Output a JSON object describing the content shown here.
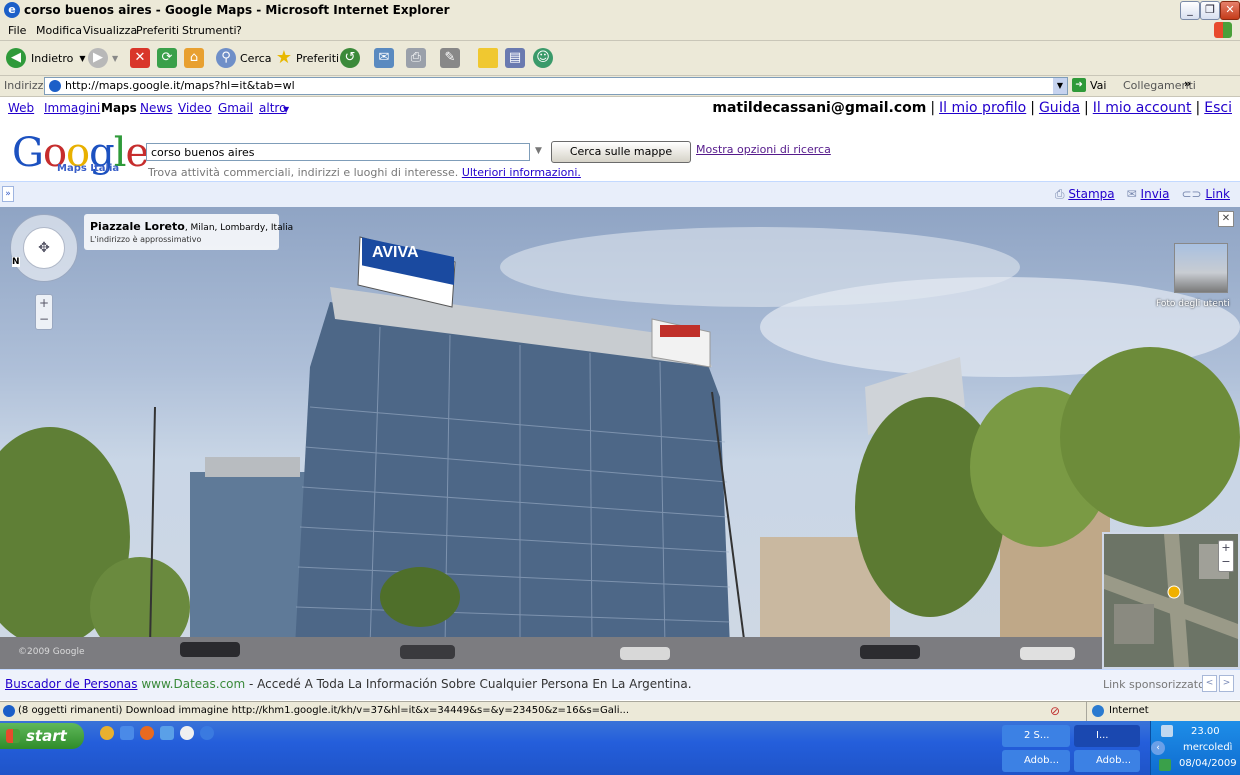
{
  "window": {
    "title": "corso buenos aires - Google Maps - Microsoft Internet Explorer"
  },
  "menu": [
    "File",
    "Modifica",
    "Visualizza",
    "Preferiti",
    "Strumenti",
    "?"
  ],
  "toolbar": {
    "back_label": "Indietro",
    "search_label": "Cerca",
    "favorites_label": "Preferiti"
  },
  "address": {
    "label": "Indirizzo",
    "url": "http://maps.google.it/maps?hl=it&tab=wl",
    "go_label": "Vai",
    "links_label": "Collegamenti"
  },
  "google_nav": {
    "links": [
      "Web",
      "Immagini",
      "Maps",
      "News",
      "Video",
      "Gmail",
      "altro"
    ],
    "active": "Maps",
    "user_email": "matildecassani@gmail.com",
    "account_links": [
      "Il mio profilo",
      "Guida",
      "Il mio account",
      "Esci"
    ]
  },
  "logo": {
    "text": "Google",
    "sub": "Maps Italia"
  },
  "search": {
    "query": "corso buenos aires",
    "button_label": "Cerca sulle mappe",
    "options_link": "Mostra opzioni di ricerca",
    "hint": "Trova attività commerciali, indirizzi e luoghi di interesse.",
    "hint_link": "Ulteriori informazioni."
  },
  "actions": {
    "print": "Stampa",
    "send": "Invia",
    "link": "Link"
  },
  "streetview": {
    "place": "Piazzale Loreto",
    "place_detail": ", Milan, Lombardy, Italia",
    "approx_note": "L'indirizzo è approssimativo",
    "user_photos_label": "Foto degli utenti",
    "sign_aviva": "AVIVA",
    "copyright": "©2009 Google"
  },
  "ad": {
    "link_text": "Buscador de Personas",
    "domain": "www.Dateas.com",
    "text": " - Accedé A Toda La Información Sobre Cualquier Persona En La Argentina.",
    "sponsored": "Link sponsorizzato"
  },
  "status": {
    "text": "(8 oggetti rimanenti) Download immagine http://khm1.google.it/kh/v=37&hl=it&x=34449&s=&y=23450&z=16&s=Gali...",
    "zone": "Internet"
  },
  "taskbar": {
    "start_label": "start",
    "tasks": [
      "2 S...",
      "I...",
      "Adob...",
      "Adob..."
    ],
    "clock_time": "23.00",
    "clock_day": "mercoledì",
    "clock_date": "08/04/2009"
  },
  "colors": {
    "link": "#2200cc",
    "taskbar": "#245edb",
    "start": "#3c9a37"
  }
}
